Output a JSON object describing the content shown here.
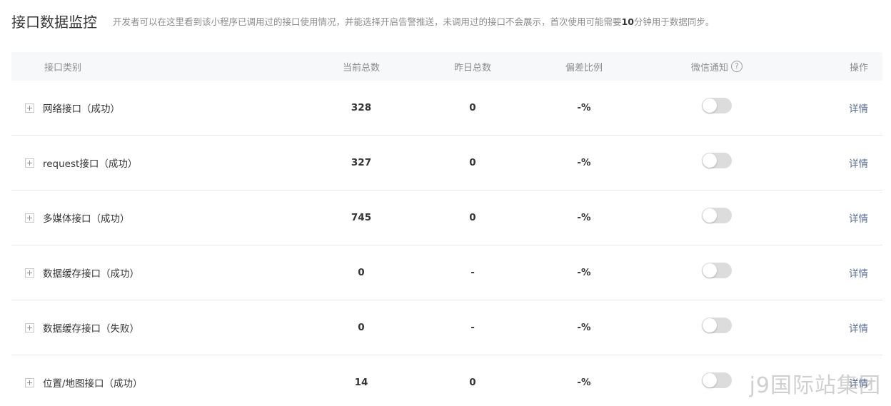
{
  "header": {
    "title": "接口数据监控",
    "description_before": "开发者可以在这里看到该小程序已调用过的接口使用情况，并能选择开启告警推送，未调用过的接口不会展示，首次使用可能需要",
    "description_bold": "10",
    "description_after": "分钟用于数据同步。"
  },
  "table": {
    "columns": {
      "type": "接口类别",
      "current": "当前总数",
      "yesterday": "昨日总数",
      "deviation": "偏差比例",
      "notify": "微信通知",
      "notify_help": "?",
      "operation": "操作"
    },
    "rows": [
      {
        "type": "网络接口（成功）",
        "current": "328",
        "yesterday": "0",
        "deviation": "-%",
        "notify": false,
        "op": "详情"
      },
      {
        "type": "request接口（成功）",
        "current": "327",
        "yesterday": "0",
        "deviation": "-%",
        "notify": false,
        "op": "详情"
      },
      {
        "type": "多媒体接口（成功）",
        "current": "745",
        "yesterday": "0",
        "deviation": "-%",
        "notify": false,
        "op": "详情"
      },
      {
        "type": "数据缓存接口（成功）",
        "current": "0",
        "yesterday": "-",
        "deviation": "-%",
        "notify": false,
        "op": "详情"
      },
      {
        "type": "数据缓存接口（失败）",
        "current": "0",
        "yesterday": "-",
        "deviation": "-%",
        "notify": false,
        "op": "详情"
      },
      {
        "type": "位置/地图接口（成功）",
        "current": "14",
        "yesterday": "0",
        "deviation": "-%",
        "notify": false,
        "op": "详情"
      }
    ]
  },
  "watermark": "j9国际站集团",
  "colors": {
    "link": "#576b95",
    "header_bg": "#f6f8f9",
    "toggle_off": "#dcdcdc"
  }
}
